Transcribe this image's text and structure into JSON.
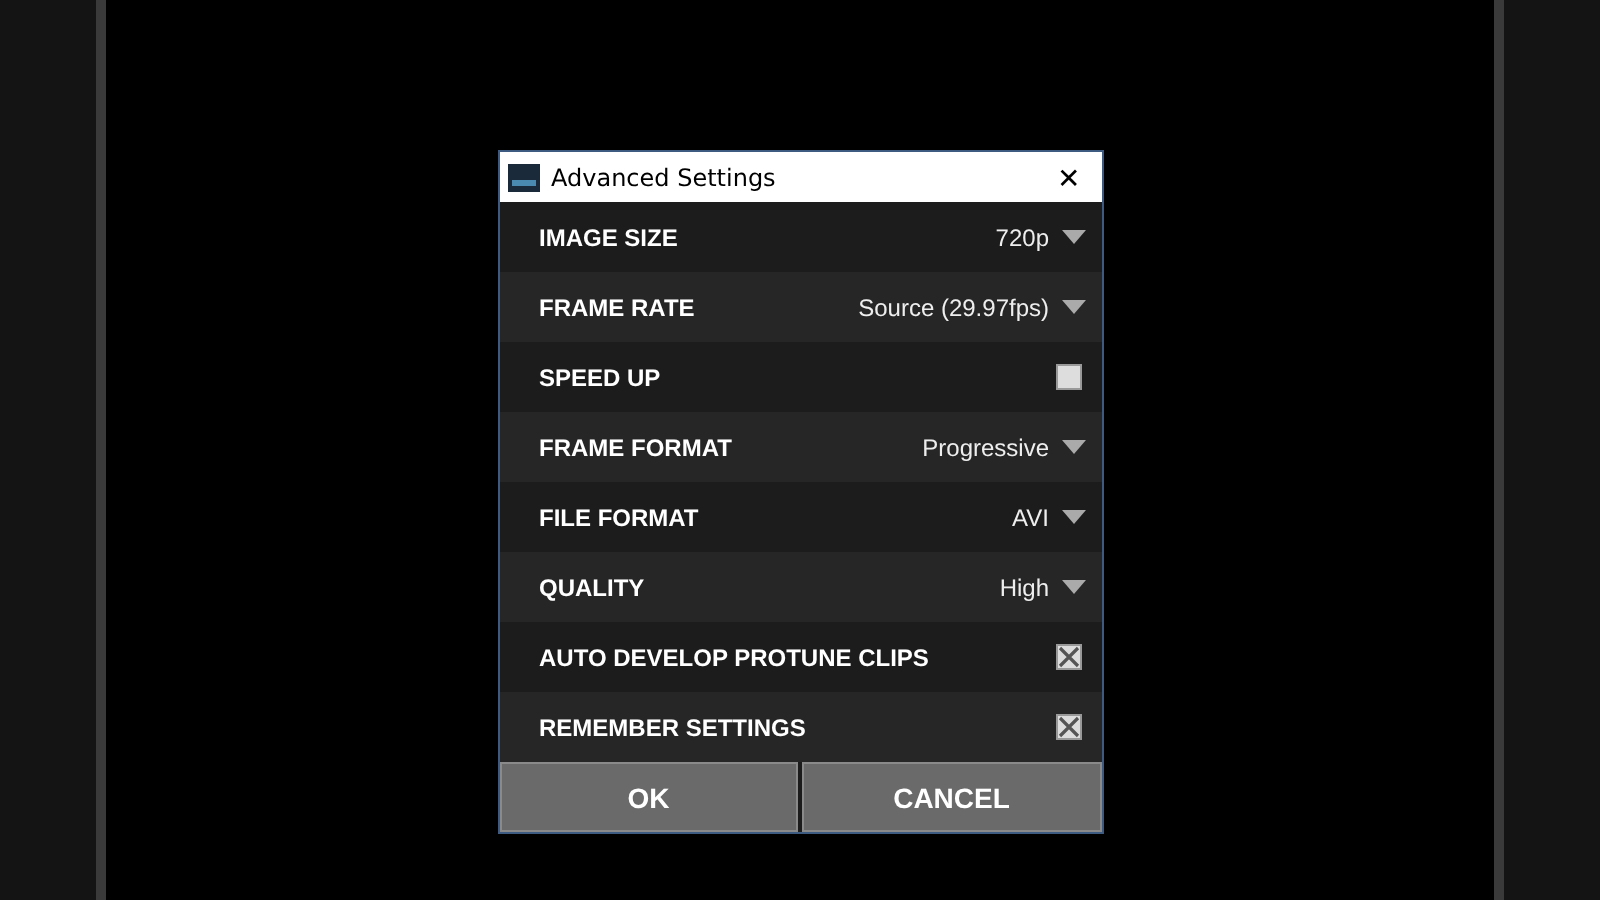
{
  "window": {
    "title": "Advanced Settings",
    "close": "✕"
  },
  "settings": [
    {
      "kind": "dropdown",
      "label": "IMAGE SIZE",
      "value": "720p"
    },
    {
      "kind": "dropdown",
      "label": "FRAME RATE",
      "value": "Source (29.97fps)"
    },
    {
      "kind": "checkbox",
      "label": "SPEED UP",
      "checked": false
    },
    {
      "kind": "dropdown",
      "label": "FRAME FORMAT",
      "value": "Progressive"
    },
    {
      "kind": "dropdown",
      "label": "FILE FORMAT",
      "value": "AVI"
    },
    {
      "kind": "dropdown",
      "label": "QUALITY",
      "value": "High"
    },
    {
      "kind": "checkbox",
      "label": "AUTO DEVELOP PROTUNE CLIPS",
      "checked": true
    },
    {
      "kind": "checkbox",
      "label": "REMEMBER SETTINGS",
      "checked": true
    }
  ],
  "buttons": [
    "OK",
    "CANCEL"
  ]
}
